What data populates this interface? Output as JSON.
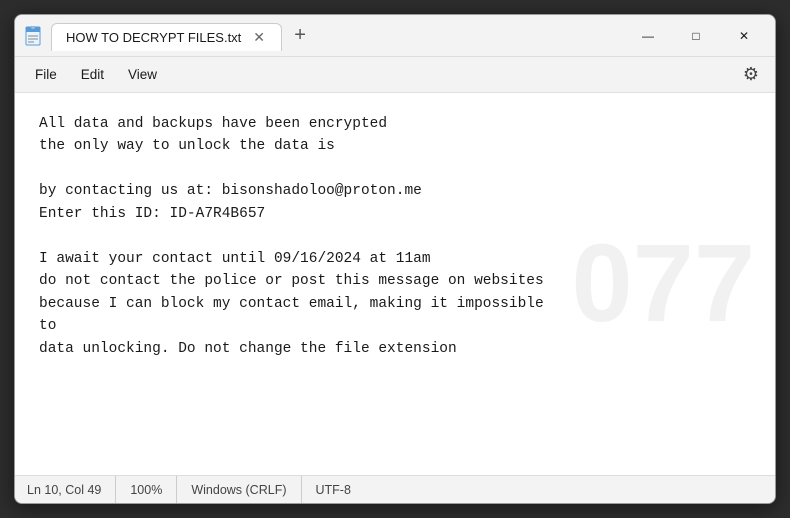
{
  "window": {
    "title": "HOW TO DECRYPT FILES.txt",
    "app_icon": "notepad",
    "tab_label": "HOW TO DECRYPT FILES.txt"
  },
  "controls": {
    "minimize": "—",
    "maximize": "□",
    "close": "✕",
    "add_tab": "+"
  },
  "menu": {
    "items": [
      "File",
      "Edit",
      "View"
    ],
    "settings_icon": "⚙"
  },
  "content": {
    "text": "All data and backups have been encrypted\nthe only way to unlock the data is\n\nby contacting us at: bisonshadoloo@proton.me\nEnter this ID: ID-A7R4B657\n\nI await your contact until 09/16/2024 at 11am\ndo not contact the police or post this message on websites\nbecause I can block my contact email, making it impossible\nto\ndata unlocking. Do not change the file extension"
  },
  "watermark": {
    "text": "077"
  },
  "statusbar": {
    "position": "Ln 10, Col 49",
    "zoom": "100%",
    "line_ending": "Windows (CRLF)",
    "encoding": "UTF-8"
  }
}
